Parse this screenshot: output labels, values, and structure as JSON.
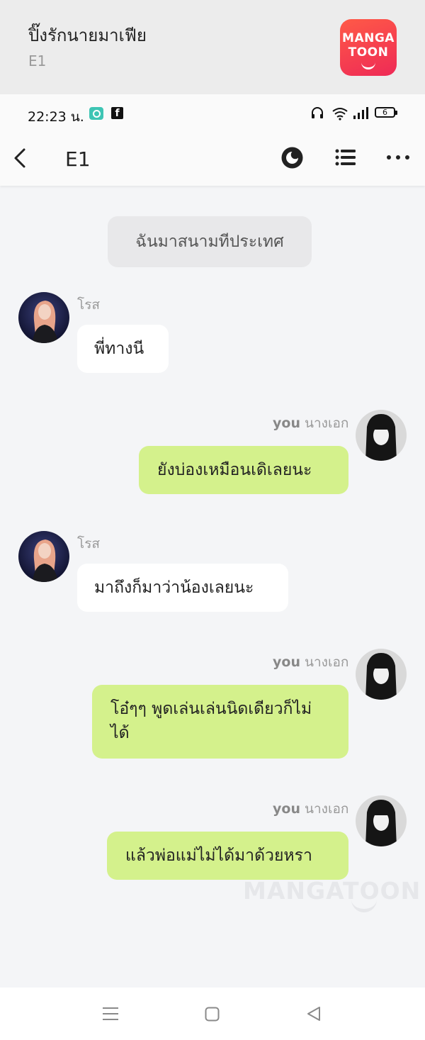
{
  "banner": {
    "story_title": "ปิ๊งรักนายมาเฟีย",
    "episode_code": "E1",
    "logo_line1": "MANGA",
    "logo_line2": "TOON"
  },
  "status_bar": {
    "time": "22:23 น.",
    "battery": "6"
  },
  "header": {
    "chapter_title": "E1",
    "icons": [
      "back-arrow-icon",
      "theme-toggle-icon",
      "list-icon",
      "more-icon"
    ]
  },
  "chat": {
    "narration": "ฉันมาสนามทีประเทศ",
    "messages": [
      {
        "side": "left",
        "speaker": "โรส",
        "text": "พี่ทางนี"
      },
      {
        "side": "right",
        "speaker_tag": "you",
        "speaker": "นางเอก",
        "text": "ยังบ่องเหมือนเดิเลยนะ"
      },
      {
        "side": "left",
        "speaker": "โรส",
        "text": "มาถึงก็มาว่าน้องเลยนะ"
      },
      {
        "side": "right",
        "speaker_tag": "you",
        "speaker": "นางเอก",
        "text": "โอ๋ๆๆ พูดเล่นเล่นนิดเดียวก็ไม่ได้"
      },
      {
        "side": "right",
        "speaker_tag": "you",
        "speaker": "นางเอก",
        "text": "แล้วพ่อแม่ไม่ได้มาด้วยหรา"
      }
    ]
  },
  "watermark": "MANGATOON",
  "colors": {
    "accent_bubble": "#d4f18c",
    "left_bubble": "#ffffff",
    "background": "#f4f5f7",
    "logo_red": "#f23c4f"
  }
}
